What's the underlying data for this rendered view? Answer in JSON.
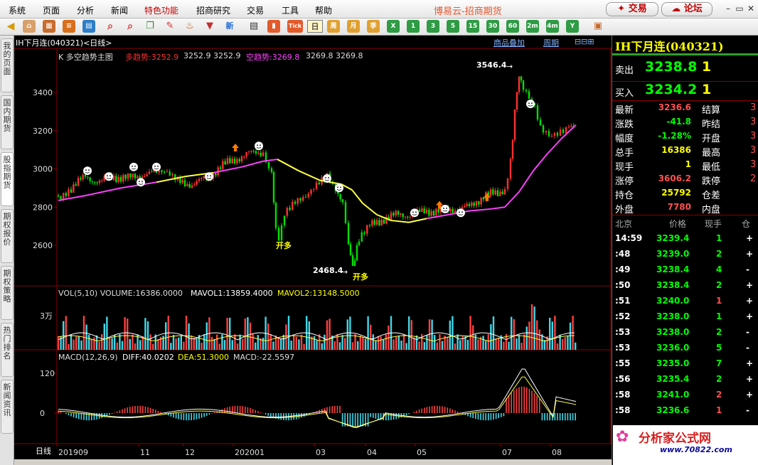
{
  "menubar": {
    "items": [
      "系统",
      "页面",
      "分析",
      "新闻",
      "特色功能",
      "招商研究",
      "交易",
      "工具",
      "帮助"
    ],
    "brand": "博易云-招商期货",
    "trade_label": "交易",
    "forum_label": "论坛"
  },
  "toolbar": {
    "periods": [
      "日",
      "周",
      "月",
      "季",
      "X",
      "1",
      "3",
      "5",
      "15",
      "30",
      "60",
      "2m",
      "4m",
      "Y"
    ],
    "tick_label": "Tick"
  },
  "lefttabs": [
    "我的页面",
    "国内期货",
    "股指期货",
    "期权报价",
    "期权策略",
    "热门排名",
    "新闻资讯"
  ],
  "chart": {
    "title": "IH下月连(040321)<日线>",
    "overlay_link": "商品叠加",
    "period_link": "周期",
    "indicator_name": "K  多空趋势主图",
    "bull_label": "多趋势:3252.9",
    "bull_vals": "3252.9 3252.9",
    "bear_label": "空趋势:3269.8",
    "bear_vals": "3269.8 3269.8",
    "vol_header": "VOL(5,10) VOLUME:16386.0000",
    "mavol1": "MAVOL1:13859.4000",
    "mavol2": "MAVOL2:13148.5000",
    "vol_unit": "3万",
    "macd_header": "MACD(12,26,9)",
    "diff": "DIFF:40.0202",
    "dea": "DEA:51.3000",
    "macd": "MACD:-22.5597",
    "high_label": "3546.4",
    "low_label": "2468.4",
    "open_long": "开多",
    "bottom_mode": "日线",
    "price_ticks": [
      "3400",
      "3200",
      "3000",
      "2800",
      "2600"
    ],
    "macd_ticks": [
      "120",
      "0"
    ],
    "x_ticks": [
      "201909",
      "11",
      "12",
      "202001",
      "03",
      "04",
      "05",
      "07",
      "08"
    ]
  },
  "chart_data": {
    "type": "candlestick",
    "title": "IH下月连(040321)<日线>",
    "x_ticks": [
      "201909",
      "11",
      "12",
      "202001",
      "03",
      "04",
      "05",
      "07",
      "08"
    ],
    "y_ticks": [
      2600,
      2800,
      3000,
      3200,
      3400
    ],
    "annotations": [
      {
        "label": "3546.4",
        "type": "high"
      },
      {
        "label": "2468.4",
        "type": "low"
      }
    ],
    "series": [
      {
        "name": "多趋势",
        "last": 3252.9
      },
      {
        "name": "空趋势",
        "last": 3269.8
      }
    ],
    "macd": {
      "diff": 40.0202,
      "dea": 51.3,
      "macd": -22.5597
    },
    "volume": {
      "volume": 16386,
      "mavol1": 13859.4,
      "mavol2": 13148.5
    }
  },
  "quote": {
    "name": "IH下月连(040321)",
    "ask_label": "卖出",
    "ask_price": "3238.8",
    "ask_qty": "1",
    "bid_label": "买入",
    "bid_price": "3234.2",
    "bid_qty": "1",
    "stats": [
      {
        "l": "最新",
        "v": "3236.6",
        "c": "#ff5050",
        "l2": "结算",
        "v2": "3"
      },
      {
        "l": "涨跌",
        "v": "-41.8",
        "c": "#00ff00",
        "l2": "昨结",
        "v2": "3"
      },
      {
        "l": "幅度",
        "v": "-1.28%",
        "c": "#00ff00",
        "l2": "开盘",
        "v2": "3"
      },
      {
        "l": "总手",
        "v": "16386",
        "c": "#ffff00",
        "l2": "最高",
        "v2": "3"
      },
      {
        "l": "现手",
        "v": "1",
        "c": "#ffff00",
        "l2": "最低",
        "v2": "3"
      },
      {
        "l": "涨停",
        "v": "3606.2",
        "c": "#ff5050",
        "l2": "跌停",
        "v2": "2"
      },
      {
        "l": "持仓",
        "v": "25792",
        "c": "#ffff00",
        "l2": "仓差",
        "v2": ""
      },
      {
        "l": "外盘",
        "v": "7780",
        "c": "#ff5050",
        "l2": "内盘",
        "v2": ""
      }
    ],
    "tick_headers": [
      "北京",
      "价格",
      "现手",
      "仓"
    ],
    "ticks": [
      {
        "t": "14:59",
        "p": "3239.4",
        "pc": "#00ff00",
        "q": "1",
        "qc": "#00ff00",
        "s": "+"
      },
      {
        "t": ":48",
        "p": "3239.0",
        "pc": "#00ff00",
        "q": "2",
        "qc": "#00ff00",
        "s": "+"
      },
      {
        "t": ":49",
        "p": "3238.4",
        "pc": "#00ff00",
        "q": "4",
        "qc": "#00ff00",
        "s": "-"
      },
      {
        "t": ":50",
        "p": "3238.4",
        "pc": "#00ff00",
        "q": "2",
        "qc": "#00ff00",
        "s": "+"
      },
      {
        "t": ":51",
        "p": "3240.0",
        "pc": "#00ff00",
        "q": "1",
        "qc": "#ff5050",
        "s": "+"
      },
      {
        "t": ":52",
        "p": "3238.0",
        "pc": "#00ff00",
        "q": "1",
        "qc": "#00ff00",
        "s": "+"
      },
      {
        "t": ":53",
        "p": "3238.0",
        "pc": "#00ff00",
        "q": "2",
        "qc": "#00ff00",
        "s": "-"
      },
      {
        "t": ":53",
        "p": "3236.0",
        "pc": "#00ff00",
        "q": "5",
        "qc": "#00ff00",
        "s": "-"
      },
      {
        "t": ":55",
        "p": "3235.0",
        "pc": "#00ff00",
        "q": "7",
        "qc": "#00ff00",
        "s": "+"
      },
      {
        "t": ":56",
        "p": "3235.4",
        "pc": "#00ff00",
        "q": "2",
        "qc": "#00ff00",
        "s": "+"
      },
      {
        "t": ":58",
        "p": "3241.0",
        "pc": "#00ff00",
        "q": "2",
        "qc": "#ff5050",
        "s": "+"
      },
      {
        "t": ":58",
        "p": "3236.6",
        "pc": "#00ff00",
        "q": "1",
        "qc": "#ff5050",
        "s": "-"
      }
    ],
    "watermark": "分析家公式网",
    "watermark_url": "www.70822.com"
  }
}
